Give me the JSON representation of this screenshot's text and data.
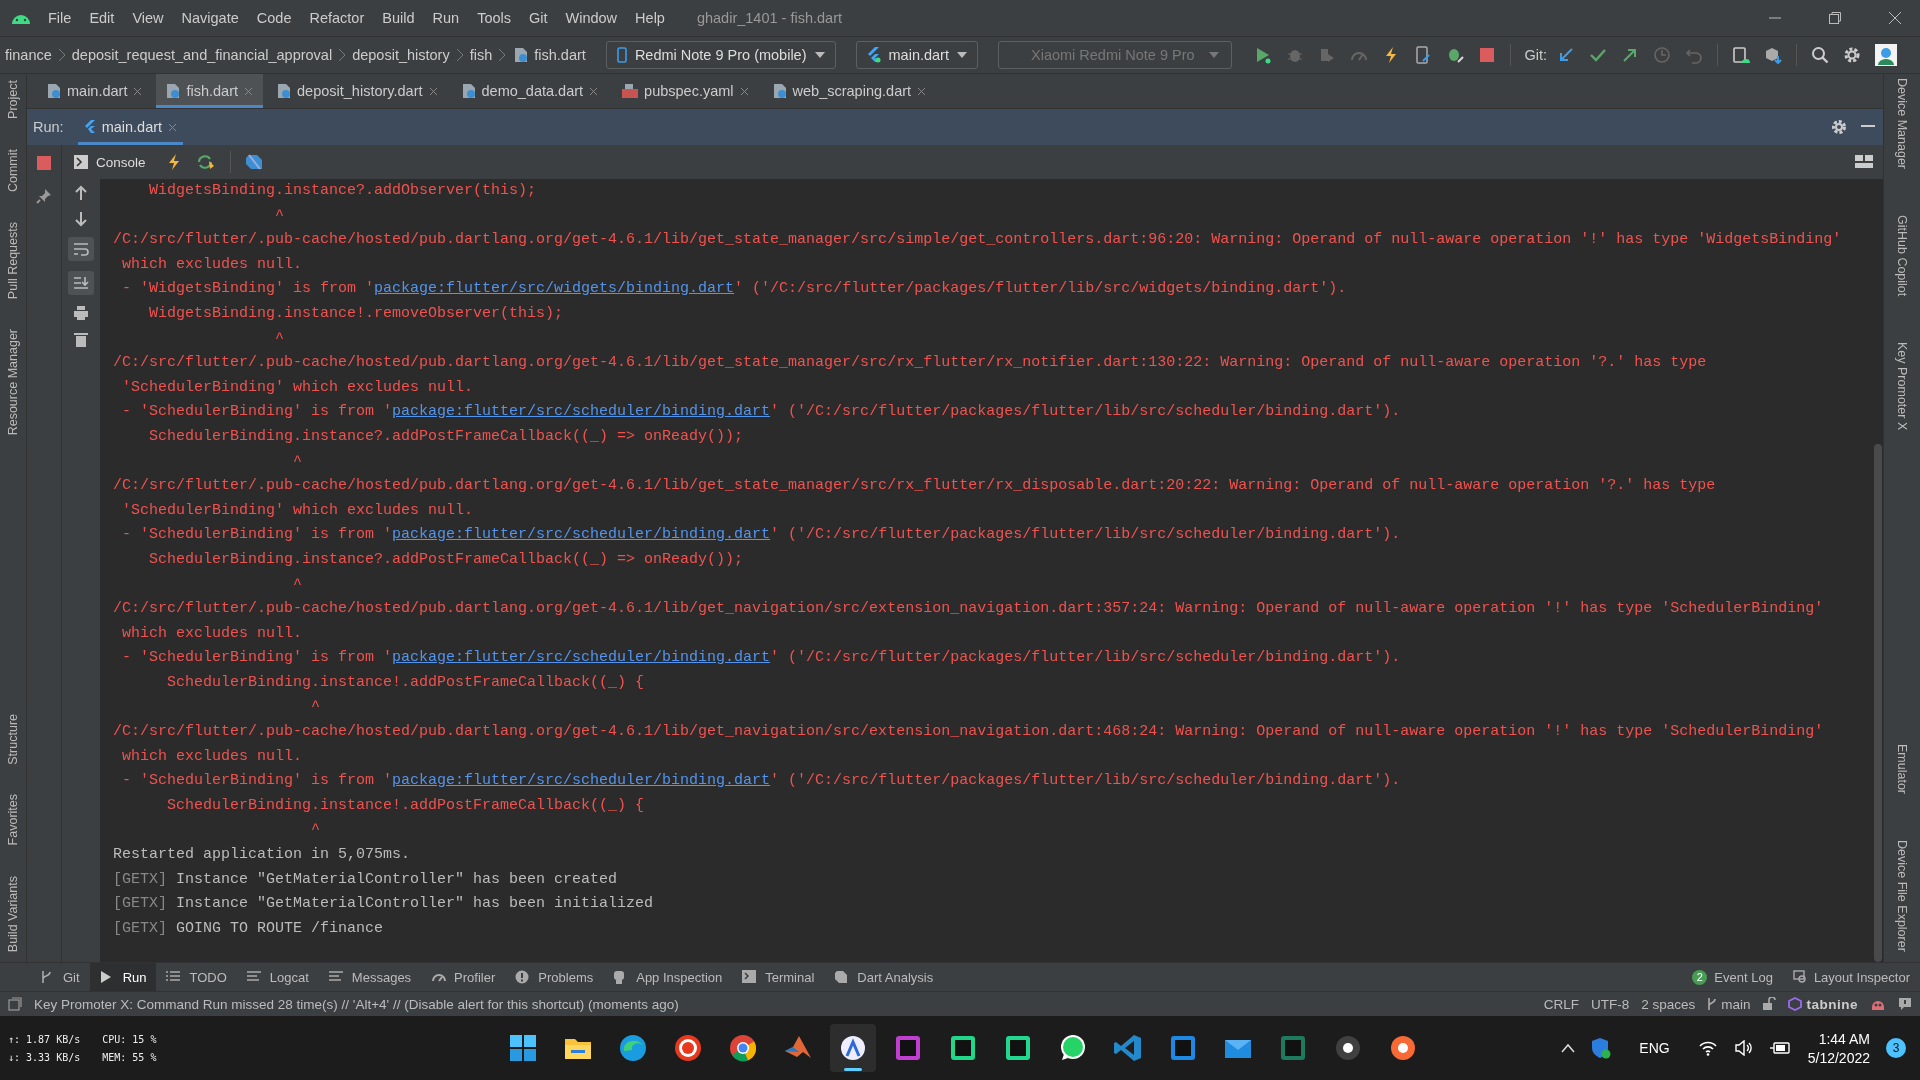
{
  "window": {
    "title": "ghadir_1401 - fish.dart"
  },
  "menu": [
    "File",
    "Edit",
    "View",
    "Navigate",
    "Code",
    "Refactor",
    "Build",
    "Run",
    "Tools",
    "Git",
    "Window",
    "Help"
  ],
  "breadcrumbs": [
    {
      "label": "finance",
      "kind": "folder"
    },
    {
      "label": "deposit_request_and_financial_approval",
      "kind": "folder"
    },
    {
      "label": "deposit_history",
      "kind": "folder"
    },
    {
      "label": "fish",
      "kind": "folder"
    },
    {
      "label": "fish.dart",
      "kind": "file"
    }
  ],
  "toolbar": {
    "device": "Redmi Note 9 Pro (mobile)",
    "config": "main.dart",
    "target": {
      "label": "Xiaomi Redmi Note 9 Pro",
      "disabled": true
    },
    "git_label": "Git:"
  },
  "editor_tabs": [
    {
      "label": "main.dart",
      "kind": "dart",
      "selected": false
    },
    {
      "label": "fish.dart",
      "kind": "dart",
      "selected": true
    },
    {
      "label": "deposit_history.dart",
      "kind": "dart",
      "selected": false
    },
    {
      "label": "demo_data.dart",
      "kind": "dart",
      "selected": false
    },
    {
      "label": "pubspec.yaml",
      "kind": "yaml",
      "selected": false
    },
    {
      "label": "web_scraping.dart",
      "kind": "dart",
      "selected": false
    }
  ],
  "left_tools_top": [
    "Project",
    "Commit",
    "Pull Requests",
    "Resource Manager"
  ],
  "left_tools_bottom": [
    "Structure",
    "Favorites",
    "Build Variants"
  ],
  "right_tools_top": [
    "Device Manager",
    "GitHub Copilot",
    "Key Promoter X"
  ],
  "right_tools_bottom": [
    "Emulator",
    "Device File Explorer"
  ],
  "run": {
    "label": "Run:",
    "tabs": [
      {
        "label": "main.dart",
        "selected": true
      }
    ],
    "console_button": "Console"
  },
  "console": [
    {
      "kind": "error",
      "text": "    WidgetsBinding.instance?.addObserver(this);"
    },
    {
      "kind": "error",
      "text": "                  ^"
    },
    {
      "kind": "error",
      "text": "/C:/src/flutter/.pub-cache/hosted/pub.dartlang.org/get-4.6.1/lib/get_state_manager/src/simple/get_controllers.dart:96:20: Warning: Operand of null-aware operation '!' has type 'WidgetsBinding'"
    },
    {
      "kind": "error",
      "text": " which excludes null."
    },
    {
      "kind": "ref",
      "prefix": " - 'WidgetsBinding' is from '",
      "link": "package:flutter/src/widgets/binding.dart",
      "suffix": "' ('/C:/src/flutter/packages/flutter/lib/src/widgets/binding.dart')."
    },
    {
      "kind": "error",
      "text": "    WidgetsBinding.instance!.removeObserver(this);"
    },
    {
      "kind": "error",
      "text": "                  ^"
    },
    {
      "kind": "error",
      "text": "/C:/src/flutter/.pub-cache/hosted/pub.dartlang.org/get-4.6.1/lib/get_state_manager/src/rx_flutter/rx_notifier.dart:130:22: Warning: Operand of null-aware operation '?.' has type"
    },
    {
      "kind": "error",
      "text": " 'SchedulerBinding' which excludes null."
    },
    {
      "kind": "ref",
      "prefix": " - 'SchedulerBinding' is from '",
      "link": "package:flutter/src/scheduler/binding.dart",
      "suffix": "' ('/C:/src/flutter/packages/flutter/lib/src/scheduler/binding.dart')."
    },
    {
      "kind": "error",
      "text": "    SchedulerBinding.instance?.addPostFrameCallback((_) => onReady());"
    },
    {
      "kind": "error",
      "text": "                    ^"
    },
    {
      "kind": "error",
      "text": "/C:/src/flutter/.pub-cache/hosted/pub.dartlang.org/get-4.6.1/lib/get_state_manager/src/rx_flutter/rx_disposable.dart:20:22: Warning: Operand of null-aware operation '?.' has type"
    },
    {
      "kind": "error",
      "text": " 'SchedulerBinding' which excludes null."
    },
    {
      "kind": "ref",
      "prefix": " - 'SchedulerBinding' is from '",
      "link": "package:flutter/src/scheduler/binding.dart",
      "suffix": "' ('/C:/src/flutter/packages/flutter/lib/src/scheduler/binding.dart')."
    },
    {
      "kind": "error",
      "text": "    SchedulerBinding.instance?.addPostFrameCallback((_) => onReady());"
    },
    {
      "kind": "error",
      "text": "                    ^"
    },
    {
      "kind": "error",
      "text": "/C:/src/flutter/.pub-cache/hosted/pub.dartlang.org/get-4.6.1/lib/get_navigation/src/extension_navigation.dart:357:24: Warning: Operand of null-aware operation '!' has type 'SchedulerBinding'"
    },
    {
      "kind": "error",
      "text": " which excludes null."
    },
    {
      "kind": "ref",
      "prefix": " - 'SchedulerBinding' is from '",
      "link": "package:flutter/src/scheduler/binding.dart",
      "suffix": "' ('/C:/src/flutter/packages/flutter/lib/src/scheduler/binding.dart')."
    },
    {
      "kind": "error",
      "text": "      SchedulerBinding.instance!.addPostFrameCallback((_) {"
    },
    {
      "kind": "error",
      "text": "                      ^"
    },
    {
      "kind": "error",
      "text": "/C:/src/flutter/.pub-cache/hosted/pub.dartlang.org/get-4.6.1/lib/get_navigation/src/extension_navigation.dart:468:24: Warning: Operand of null-aware operation '!' has type 'SchedulerBinding'"
    },
    {
      "kind": "error",
      "text": " which excludes null."
    },
    {
      "kind": "ref",
      "prefix": " - 'SchedulerBinding' is from '",
      "link": "package:flutter/src/scheduler/binding.dart",
      "suffix": "' ('/C:/src/flutter/packages/flutter/lib/src/scheduler/binding.dart')."
    },
    {
      "kind": "error",
      "text": "      SchedulerBinding.instance!.addPostFrameCallback((_) {"
    },
    {
      "kind": "error",
      "text": "                      ^"
    },
    {
      "kind": "info",
      "text": "Restarted application in 5,075ms."
    },
    {
      "kind": "getx",
      "tag": "[GETX]",
      "text": " Instance \"GetMaterialController\" has been created"
    },
    {
      "kind": "getx",
      "tag": "[GETX]",
      "text": " Instance \"GetMaterialController\" has been initialized"
    },
    {
      "kind": "getx",
      "tag": "[GETX]",
      "text": " GOING TO ROUTE /finance"
    }
  ],
  "tool_tabs": [
    {
      "label": "Git",
      "kind": "git",
      "selected": false
    },
    {
      "label": "Run",
      "kind": "run",
      "selected": true
    },
    {
      "label": "TODO",
      "kind": "list",
      "selected": false
    },
    {
      "label": "Logcat",
      "kind": "lines",
      "selected": false
    },
    {
      "label": "Messages",
      "kind": "lines",
      "selected": false
    },
    {
      "label": "Profiler",
      "kind": "gauge",
      "selected": false
    },
    {
      "label": "Problems",
      "kind": "alert",
      "selected": false
    },
    {
      "label": "App Inspection",
      "kind": "bot",
      "selected": false
    },
    {
      "label": "Terminal",
      "kind": "terminal",
      "selected": false
    },
    {
      "label": "Dart Analysis",
      "kind": "dart",
      "selected": false
    }
  ],
  "right_tool_tabs": [
    {
      "label": "Event Log",
      "badge": "2"
    },
    {
      "label": "Layout Inspector"
    }
  ],
  "status_bar": {
    "message": "Key Promoter X: Command Run missed 28 time(s) // 'Alt+4' // (Disable alert for this shortcut) (moments ago)",
    "items": [
      "CRLF",
      "UTF-8",
      "2 spaces"
    ],
    "branch": "main",
    "plugin": "tabnine"
  },
  "taskbar": {
    "net_up": "↑: 1.87 KB/s",
    "net_down": "↓: 3.33 KB/s",
    "cpu": "CPU: 15 %",
    "mem": "MEM: 55 %",
    "apps": [
      {
        "kind": "start",
        "selected": false
      },
      {
        "kind": "folder",
        "selected": false
      },
      {
        "kind": "edge",
        "selected": false
      },
      {
        "kind": "record",
        "selected": false
      },
      {
        "kind": "chrome",
        "selected": false
      },
      {
        "kind": "matlab",
        "selected": false
      },
      {
        "kind": "studio",
        "selected": true
      },
      {
        "kind": "square",
        "color": "#c03fd0",
        "selected": false
      },
      {
        "kind": "square",
        "color": "#21d789",
        "selected": false
      },
      {
        "kind": "square",
        "color": "#22d88f",
        "selected": false
      },
      {
        "kind": "whatsapp",
        "selected": false
      },
      {
        "kind": "vscode",
        "selected": false
      },
      {
        "kind": "square",
        "color": "#1e88e5",
        "selected": false
      },
      {
        "kind": "mail",
        "selected": false
      },
      {
        "kind": "square",
        "color": "#1d7a5c",
        "selected": false
      },
      {
        "kind": "circle",
        "color": "#404040",
        "selected": false
      },
      {
        "kind": "circle",
        "color": "#f76935",
        "selected": false
      }
    ],
    "language": "ENG",
    "time": "1:44 AM",
    "date": "5/12/2022",
    "notifications": "3"
  }
}
